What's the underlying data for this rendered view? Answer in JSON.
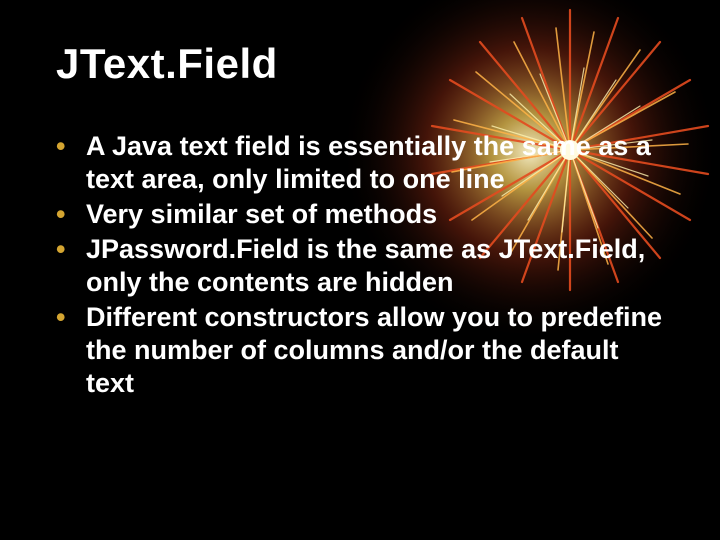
{
  "slide": {
    "title": "JText.Field",
    "bullets": [
      "A Java text field is essentially the same as a text area, only limited to one line",
      "Very similar set of methods",
      "JPassword.Field is the same as JText.Field, only the contents are hidden",
      "Different constructors allow you to predefine the number of columns and/or the default text"
    ]
  }
}
